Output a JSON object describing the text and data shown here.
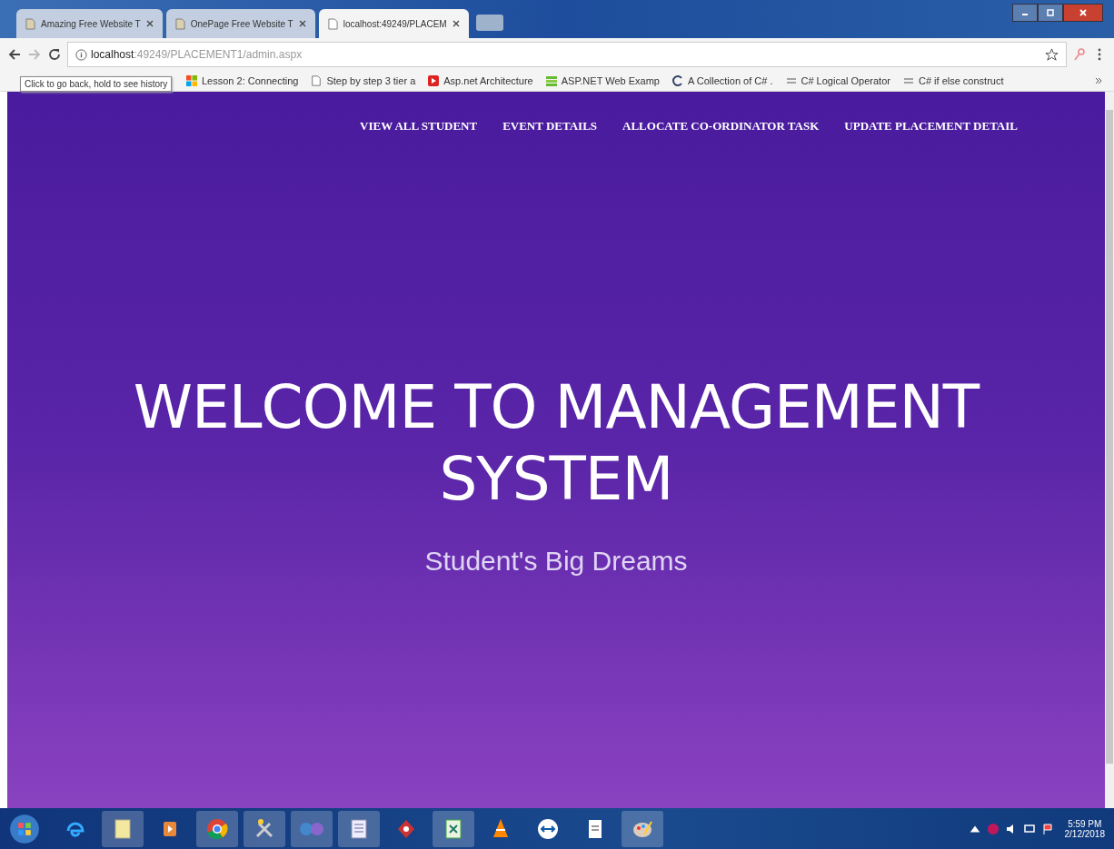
{
  "browser": {
    "tabs": [
      {
        "title": "Amazing Free Website T",
        "selected": false
      },
      {
        "title": "OnePage Free Website T",
        "selected": false
      },
      {
        "title": "localhost:49249/PLACEM",
        "selected": true
      }
    ],
    "address": {
      "host": "localhost",
      "path": ":49249/PLACEMENT1/admin.aspx"
    },
    "bookmarks": [
      {
        "label": "Lesson 2: Connecting",
        "kind": "tiles"
      },
      {
        "label": "Step by step 3 tier a",
        "kind": "page"
      },
      {
        "label": "Asp.net Architecture",
        "kind": "red"
      },
      {
        "label": "ASP.NET Web Examp",
        "kind": "green"
      },
      {
        "label": "A Collection of C# .",
        "kind": "c"
      },
      {
        "label": "C# Logical Operator",
        "kind": "lines"
      },
      {
        "label": "C# if else construct",
        "kind": "lines"
      }
    ],
    "tooltip": "Click to go back, hold to see history"
  },
  "nav": {
    "links": [
      "VIEW ALL STUDENT",
      "EVENT DETAILS",
      "ALLOCATE CO-ORDINATOR TASK",
      "UPDATE PLACEMENT DETAIL"
    ]
  },
  "hero": {
    "title": "WELCOME TO MANAGEMENT SYSTEM",
    "subtitle": "Student's Big Dreams"
  },
  "taskbar": {
    "apps": [
      {
        "kind": "ie",
        "selected": false
      },
      {
        "kind": "notepad",
        "selected": true
      },
      {
        "kind": "media",
        "selected": false
      },
      {
        "kind": "chrome",
        "selected": true
      },
      {
        "kind": "tools",
        "selected": true
      },
      {
        "kind": "vs",
        "selected": true
      },
      {
        "kind": "doc",
        "selected": true
      },
      {
        "kind": "red",
        "selected": false
      },
      {
        "kind": "excel",
        "selected": true
      },
      {
        "kind": "vlc",
        "selected": false
      },
      {
        "kind": "teamviewer",
        "selected": false
      },
      {
        "kind": "file",
        "selected": false
      },
      {
        "kind": "paint",
        "selected": true
      }
    ],
    "time": "5:59 PM",
    "date": "2/12/2018"
  }
}
